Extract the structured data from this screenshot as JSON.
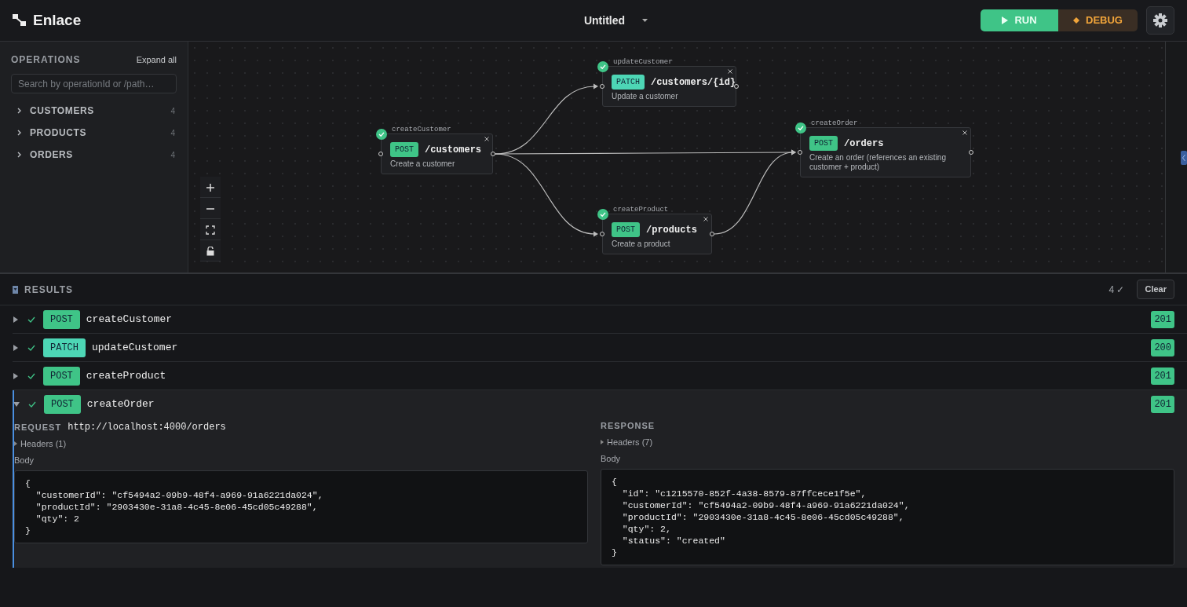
{
  "header": {
    "logo": "Enlace",
    "document_title": "Untitled",
    "run_label": "RUN",
    "debug_label": "DEBUG"
  },
  "sidebar": {
    "title": "OPERATIONS",
    "expand_all": "Expand all",
    "search": {
      "placeholder": "Search by operationId or /path…"
    },
    "groups": [
      {
        "name": "CUSTOMERS",
        "count": "4",
        "expanded": false
      },
      {
        "name": "PRODUCTS",
        "count": "4",
        "expanded": false
      },
      {
        "name": "ORDERS",
        "count": "4",
        "expanded": false
      }
    ]
  },
  "canvas": {
    "nodes": [
      {
        "operation_id": "createCustomer",
        "method": "POST",
        "color": "#3fc487",
        "path": "/customers",
        "description": "Create a customer",
        "passed": true
      },
      {
        "operation_id": "updateCustomer",
        "method": "PATCH",
        "color": "#4dd6b5",
        "path": "/customers/{id}",
        "description": "Update a customer",
        "passed": true
      },
      {
        "operation_id": "createProduct",
        "method": "POST",
        "color": "#3fc487",
        "path": "/products",
        "description": "Create a product",
        "passed": true
      },
      {
        "operation_id": "createOrder",
        "method": "POST",
        "color": "#3fc487",
        "path": "/orders",
        "description": "Create an order (references an existing customer + product)",
        "passed": true
      }
    ]
  },
  "results": {
    "title": "RESULTS",
    "summary": "4 ✓",
    "clear_label": "Clear",
    "items": [
      {
        "method": "POST",
        "color": "#3fc487",
        "operation_id": "createCustomer",
        "status": "201",
        "passed": true,
        "expanded": false
      },
      {
        "method": "PATCH",
        "color": "#4dd6b5",
        "operation_id": "updateCustomer",
        "status": "200",
        "passed": true,
        "expanded": false
      },
      {
        "method": "POST",
        "color": "#3fc487",
        "operation_id": "createProduct",
        "status": "201",
        "passed": true,
        "expanded": false
      },
      {
        "method": "POST",
        "color": "#3fc487",
        "operation_id": "createOrder",
        "status": "201",
        "passed": true,
        "expanded": true
      }
    ],
    "detail": {
      "request_label": "REQUEST",
      "request_url": "http://localhost:4000/orders",
      "request_headers": "Headers (1)",
      "request_body_label": "Body",
      "request_body": "{\n  \"customerId\": \"cf5494a2-09b9-48f4-a969-91a6221da024\",\n  \"productId\": \"2903430e-31a8-4c45-8e06-45cd05c49288\",\n  \"qty\": 2\n}",
      "response_label": "RESPONSE",
      "response_headers": "Headers (7)",
      "response_body_label": "Body",
      "response_body": "{\n  \"id\": \"c1215570-852f-4a38-8579-87ffcece1f5e\",\n  \"customerId\": \"cf5494a2-09b9-48f4-a969-91a6221da024\",\n  \"productId\": \"2903430e-31a8-4c45-8e06-45cd05c49288\",\n  \"qty\": 2,\n  \"status\": \"created\"\n}"
    }
  }
}
